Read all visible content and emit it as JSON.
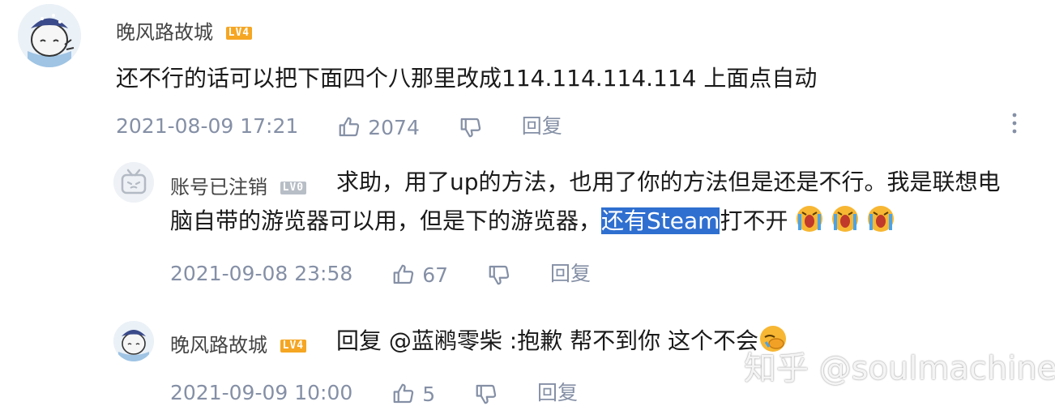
{
  "comment1": {
    "username": "晚风路故城",
    "level_badge": "LV4",
    "content": "还不行的话可以把下面四个八那里改成114.114.114.114 上面点自动",
    "timestamp": "2021-08-09 17:21",
    "likes": "2074",
    "reply_label": "回复",
    "more_icon": "more-vertical-icon"
  },
  "reply1": {
    "username": "账号已注销",
    "level_badge": "LV0",
    "content_line1": "求助，用了up的方法，也用了你的方法但是还是不行。我是联想电",
    "content_line2_prefix": "脑自带的游览器可以用，但是下的游览器，",
    "content_highlighted": "还有Steam",
    "content_line2_suffix": "打不开",
    "emoji": "crying-emoji",
    "timestamp": "2021-09-08 23:58",
    "likes": "67",
    "reply_label": "回复"
  },
  "reply2": {
    "username": "晚风路故城",
    "level_badge": "LV4",
    "content": "回复 @蓝鹇零柴 :抱歉 帮不到你 这个不会",
    "emoji": "facepalm-emoji",
    "timestamp": "2021-09-09 10:00",
    "likes": "5",
    "reply_label": "回复"
  },
  "watermark": "知乎 @soulmachine",
  "colors": {
    "meta_gray": "#8590a6",
    "highlight_blue": "#2f6fd0",
    "badge_orange": "#f5a623",
    "badge_gray": "#b8bec6"
  }
}
